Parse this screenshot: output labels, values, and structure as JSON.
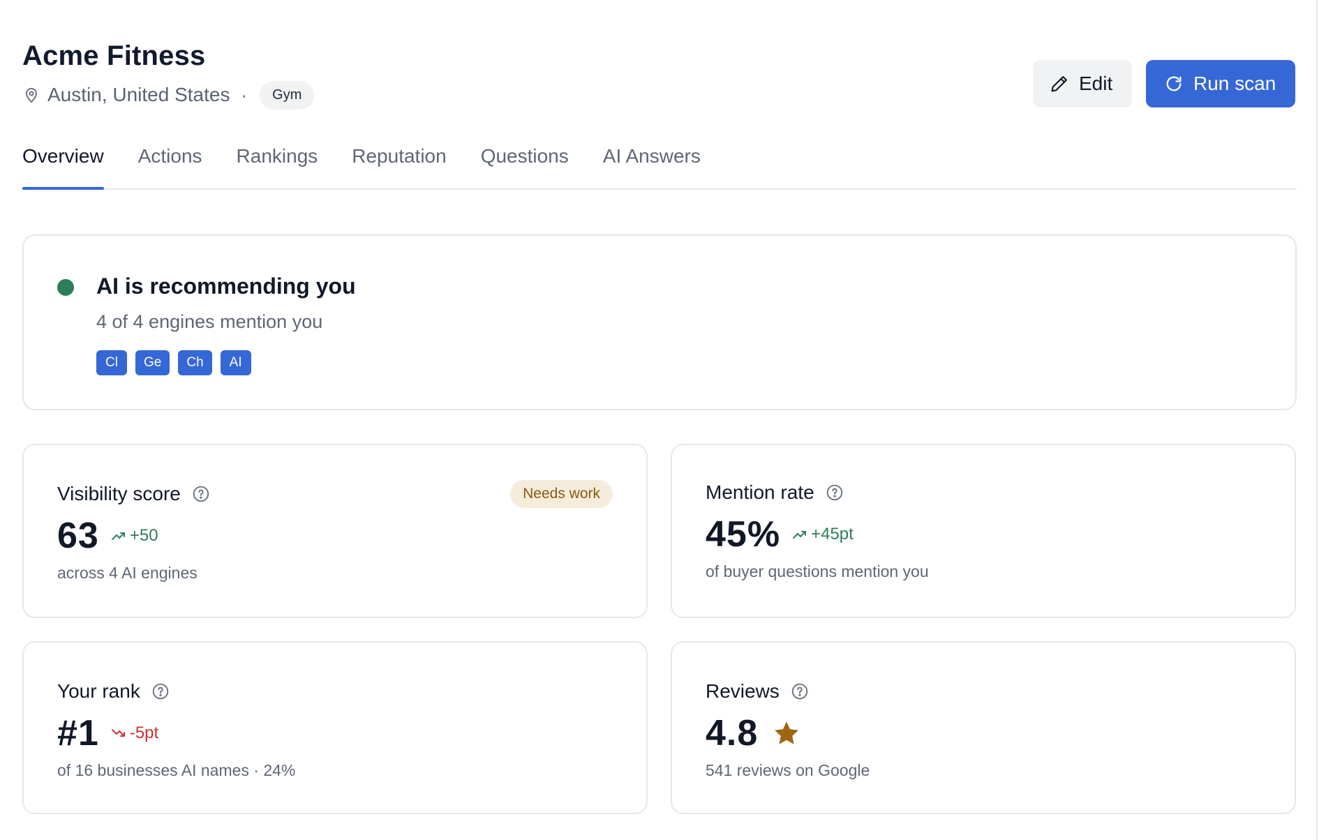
{
  "header": {
    "title": "Acme Fitness",
    "location": "Austin, United States",
    "separator": "·",
    "category": "Gym",
    "edit_label": "Edit",
    "run_scan_label": "Run scan"
  },
  "tabs": [
    {
      "label": "Overview",
      "active": true
    },
    {
      "label": "Actions",
      "active": false
    },
    {
      "label": "Rankings",
      "active": false
    },
    {
      "label": "Reputation",
      "active": false
    },
    {
      "label": "Questions",
      "active": false
    },
    {
      "label": "AI Answers",
      "active": false
    }
  ],
  "status": {
    "title": "AI is recommending you",
    "subtitle": "4 of 4 engines mention you",
    "engines": [
      "Cl",
      "Ge",
      "Ch",
      "AI"
    ],
    "dot_color": "#2e7d5b"
  },
  "metrics": {
    "visibility": {
      "label": "Visibility score",
      "value": "63",
      "delta": "+50",
      "sub": "across 4 AI engines",
      "status": "Needs work"
    },
    "mention": {
      "label": "Mention rate",
      "value": "45%",
      "delta": "+45pt",
      "sub": "of buyer questions mention you"
    },
    "rank": {
      "label": "Your rank",
      "value": "#1",
      "delta": "-5pt",
      "sub": "of 16 businesses AI names · 24%"
    },
    "reviews": {
      "label": "Reviews",
      "value": "4.8",
      "sub": "541 reviews on Google"
    }
  },
  "colors": {
    "accent": "#3567d6",
    "positive": "#2e7d5b",
    "negative": "#cf2f2f",
    "warning_bg": "#f6ecdc",
    "warning_text": "#8a5a12",
    "star": "#a0650f"
  },
  "icons": {
    "location": "map-pin-icon",
    "edit": "pencil-icon",
    "run_scan": "refresh-icon",
    "help": "question-circle-icon",
    "trend_up": "trend-up-icon",
    "trend_down": "trend-down-icon",
    "rating": "star-icon"
  }
}
